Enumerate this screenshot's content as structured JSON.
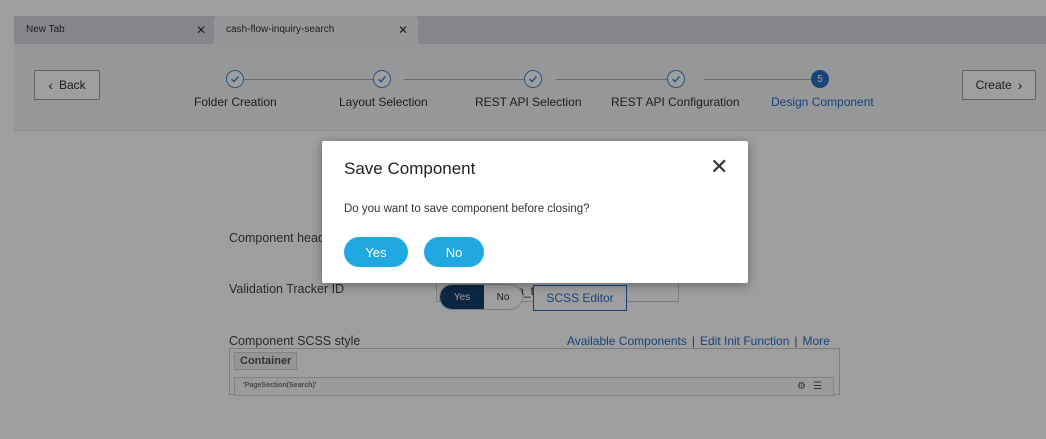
{
  "browser": {
    "tabs": [
      {
        "label": "New Tab",
        "close": "✕"
      },
      {
        "label": "cash-flow-inquiry-search",
        "close": "✕"
      }
    ]
  },
  "nav": {
    "back_label": "Back",
    "back_icon": "‹",
    "create_label": "Create",
    "create_icon": "›"
  },
  "stepper": {
    "steps": [
      {
        "label": "Folder Creation",
        "status": "done"
      },
      {
        "label": "Layout Selection",
        "status": "done"
      },
      {
        "label": "REST API Selection",
        "status": "done"
      },
      {
        "label": "REST API Configuration",
        "status": "done"
      },
      {
        "label": "Design Component",
        "status": "active",
        "number": "5"
      }
    ],
    "accent": "#2a6fc4"
  },
  "form": {
    "component_header_label": "Component header",
    "validation_tracker_label": "Validation Tracker ID",
    "validation_tracker_value": "'search_criteria_track'",
    "scss_style_label": "Component SCSS style",
    "scss_toggle_yes": "Yes",
    "scss_toggle_no": "No",
    "scss_editor_label": "SCSS Editor"
  },
  "links": {
    "available_components": "Available Components",
    "edit_init_function": "Edit Init Function",
    "more": "More",
    "separator": "|"
  },
  "container": {
    "tab_label": "Container",
    "section_label": "'PageSection(Search)'",
    "gear_icon": "⚙",
    "menu_icon": "☰"
  },
  "modal": {
    "title": "Save Component",
    "close": "✕",
    "message": "Do you want to save component before closing?",
    "yes_label": "Yes",
    "no_label": "No",
    "button_color": "#20a9e1"
  }
}
